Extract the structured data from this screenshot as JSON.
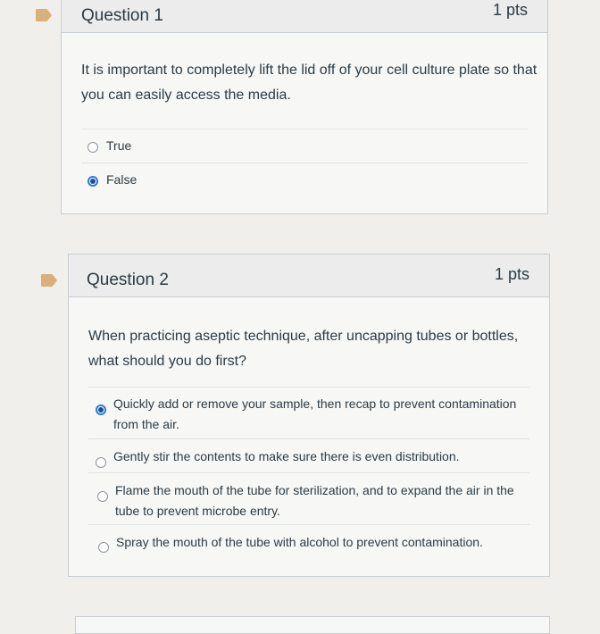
{
  "questions": [
    {
      "title": "Question 1",
      "points": "1 pts",
      "text": "It is important to completely lift the lid off of your cell culture plate so that you can easily access the media.",
      "answers": [
        {
          "label": "True",
          "selected": false
        },
        {
          "label": "False",
          "selected": true
        }
      ]
    },
    {
      "title": "Question 2",
      "points": "1 pts",
      "text": "When practicing aseptic technique, after uncapping tubes or bottles, what should you do first?",
      "answers": [
        {
          "label": "Quickly add or remove your sample, then recap to prevent contamination from the air.",
          "selected": true
        },
        {
          "label": "Gently stir the contents to make sure there is even distribution.",
          "selected": false
        },
        {
          "label": "Flame the mouth of the tube for sterilization, and to expand the air in the tube to prevent microbe entry.",
          "selected": false
        },
        {
          "label": "Spray the mouth of the tube with alcohol to prevent contamination.",
          "selected": false
        }
      ]
    }
  ],
  "colors": {
    "flag": "#d9b07a",
    "selected_radio": "#2a7ad6",
    "text": "#2d3b45"
  }
}
